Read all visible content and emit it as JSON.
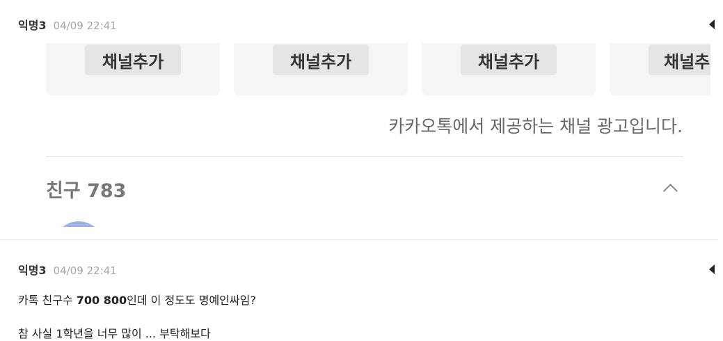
{
  "comment1": {
    "author": "익명3",
    "time": "04/09 22:41"
  },
  "embed": {
    "channel_buttons": [
      "채널추가",
      "채널추가",
      "채널추가",
      "채널추"
    ],
    "ad_text": "카카오톡에서 제공하는 채널 광고입니다.",
    "friends_label": "친구 783"
  },
  "comment2": {
    "author": "익명3",
    "time": "04/09 22:41",
    "text_prefix": "카톡 친구수 ",
    "text_bold": "700 800",
    "text_suffix": "인데 이 정도도 명예인싸임?",
    "next_line": "참 사실 1학년을 너무 많이 ... 부탁해보다"
  }
}
